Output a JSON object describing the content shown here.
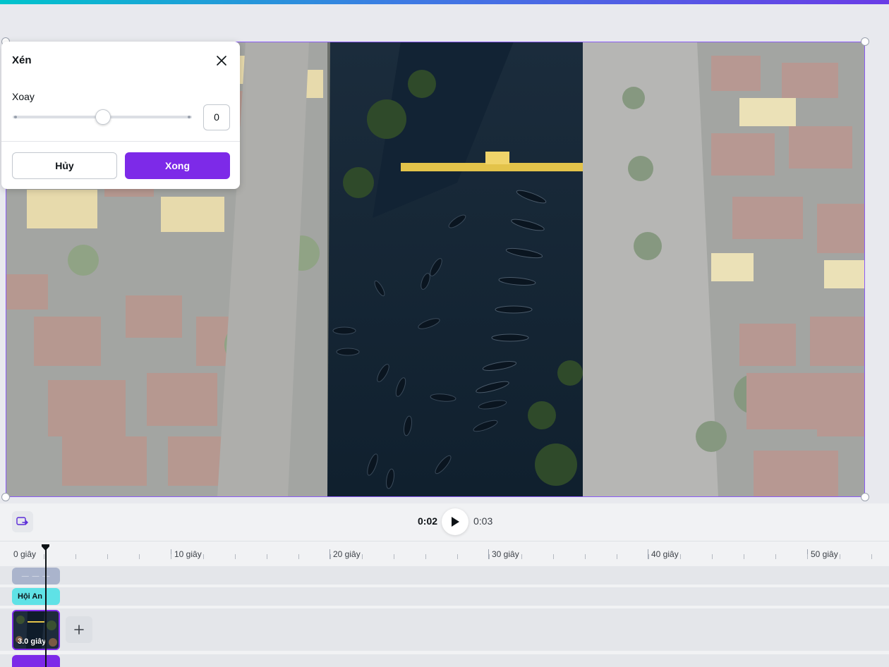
{
  "crop_panel": {
    "title": "Xén",
    "rotate_label": "Xoay",
    "rotate_value": "0",
    "rotate_slider_fraction": 0.5,
    "cancel_label": "Hủy",
    "done_label": "Xong",
    "accent_color": "#7d2ae8"
  },
  "playback": {
    "current_time": "0:02",
    "total_time": "0:03"
  },
  "timeline": {
    "ruler_labels": [
      "0 giây",
      "10 giây",
      "20 giây",
      "30 giây",
      "40 giây",
      "50 giây"
    ],
    "clips": {
      "top_track_label": "— — —",
      "text_track_label": "Hội An",
      "video_clip_label": "3.0 giây"
    }
  },
  "icons": {
    "close": "close-icon",
    "present": "present-icon",
    "play": "play-icon",
    "add": "plus-icon"
  }
}
